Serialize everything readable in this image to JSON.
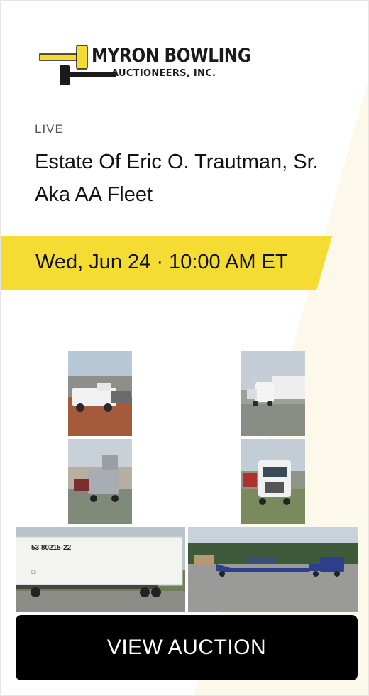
{
  "brand": {
    "name_main": "MYRON BOWLING",
    "name_sub": "AUCTIONEERS, INC.",
    "icon": "gavel-icon",
    "accent_color": "#f5dc33"
  },
  "auction": {
    "status": "LIVE",
    "title": "Estate Of Eric O. Trautman, Sr. Aka AA Fleet",
    "date": "Wed, Jun 24 · 10:00 AM ET"
  },
  "photos": [
    {
      "subject": "white-crew-cab-pickup-truck"
    },
    {
      "subject": "white-semi-truck-with-box-trailer"
    },
    {
      "subject": "silver-semi-tractor"
    },
    {
      "subject": "white-volvo-semi-tractor"
    },
    {
      "subject": "white-box-trailer",
      "trailer_text": "53  80215-22",
      "trailer_small_text": "53"
    },
    {
      "subject": "blue-tractor-with-lowboy-trailer"
    }
  ],
  "cta": {
    "label": "VIEW AUCTION"
  }
}
